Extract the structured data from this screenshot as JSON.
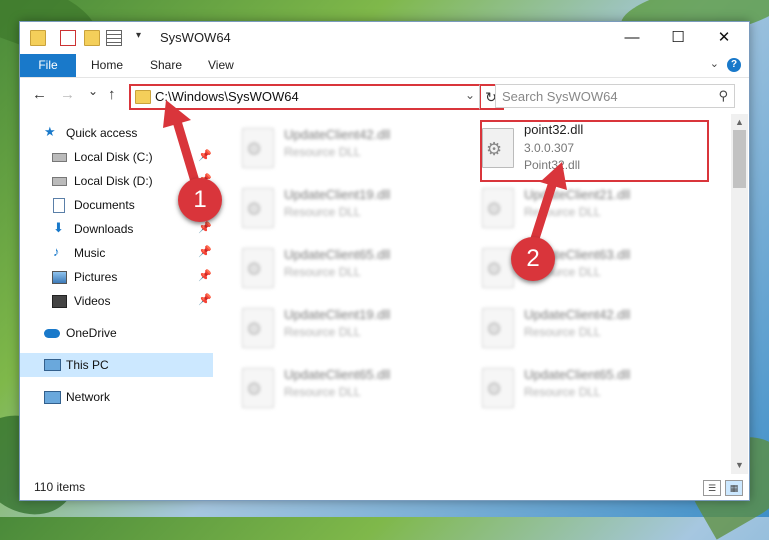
{
  "window": {
    "title": "SysWOW64",
    "minimize": "—",
    "maximize": "☐",
    "close": "✕"
  },
  "ribbon": {
    "file": "File",
    "home": "Home",
    "share": "Share",
    "view": "View",
    "help": "?"
  },
  "nav": {
    "back": "←",
    "forward": "→",
    "recent": "⌄",
    "up": "↑",
    "address": "C:\\Windows\\SysWOW64",
    "refresh": "↻",
    "search_placeholder": "Search SysWOW64"
  },
  "sidebar": {
    "items": [
      {
        "label": "Quick access",
        "pinned": false
      },
      {
        "label": "Local Disk (C:)",
        "pinned": true
      },
      {
        "label": "Local Disk (D:)",
        "pinned": true
      },
      {
        "label": "Documents",
        "pinned": true
      },
      {
        "label": "Downloads",
        "pinned": true
      },
      {
        "label": "Music",
        "pinned": true
      },
      {
        "label": "Pictures",
        "pinned": true
      },
      {
        "label": "Videos",
        "pinned": true
      },
      {
        "label": "OneDrive",
        "pinned": false
      },
      {
        "label": "This PC",
        "pinned": false
      },
      {
        "label": "Network",
        "pinned": false
      }
    ],
    "pin_glyph": "📌"
  },
  "files": [
    {
      "name": "UpdateClient42.dll",
      "desc": "Resource DLL"
    },
    {
      "name": "point32.dll",
      "version": "3.0.0.307",
      "desc": "Point32.dll"
    },
    {
      "name": "UpdateClient19.dll",
      "desc": "Resource DLL"
    },
    {
      "name": "UpdateClient21.dll",
      "desc": "Resource DLL"
    },
    {
      "name": "UpdateClient65.dll",
      "desc": "Resource DLL"
    },
    {
      "name": "UpdateClient63.dll",
      "desc": "Resource DLL"
    },
    {
      "name": "UpdateClient19.dll",
      "desc": "Resource DLL"
    },
    {
      "name": "UpdateClient42.dll",
      "desc": "Resource DLL"
    },
    {
      "name": "UpdateClient65.dll",
      "desc": "Resource DLL"
    },
    {
      "name": "UpdateClient65.dll",
      "desc": "Resource DLL"
    }
  ],
  "status": {
    "count": "110 items"
  },
  "annotations": {
    "step1": "1",
    "step2": "2",
    "color": "#d9353b"
  },
  "colors": {
    "accent": "#1979ca",
    "selected": "#cce8ff"
  }
}
